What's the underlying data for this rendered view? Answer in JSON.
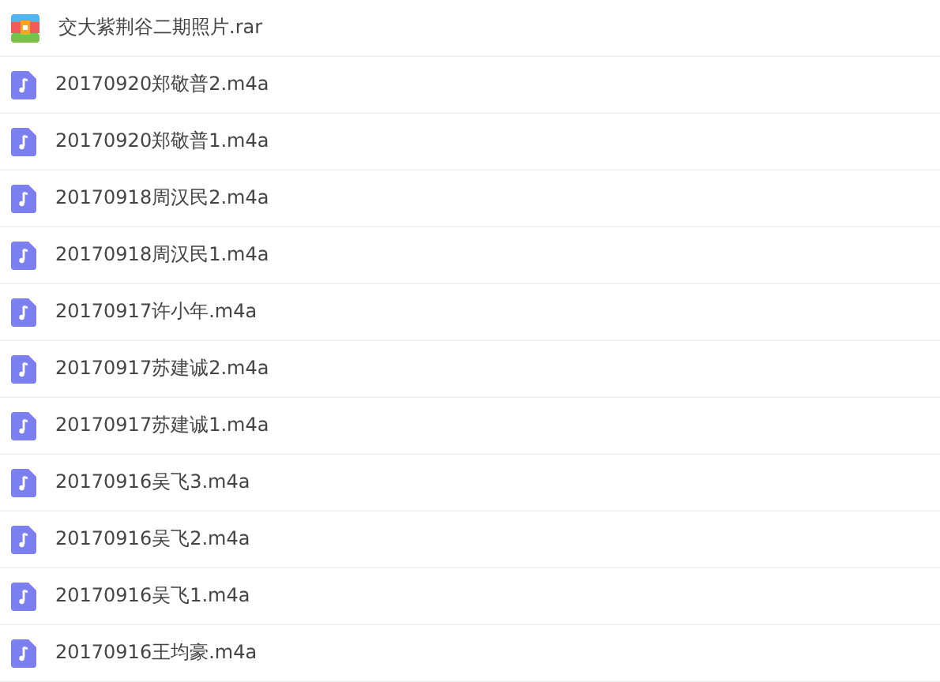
{
  "files": [
    {
      "kind": "archive",
      "name": "交大紫荆谷二期照片.rar"
    },
    {
      "kind": "audio",
      "name": "20170920郑敬普2.m4a"
    },
    {
      "kind": "audio",
      "name": "20170920郑敬普1.m4a"
    },
    {
      "kind": "audio",
      "name": "20170918周汉民2.m4a"
    },
    {
      "kind": "audio",
      "name": "20170918周汉民1.m4a"
    },
    {
      "kind": "audio",
      "name": "20170917许小年.m4a"
    },
    {
      "kind": "audio",
      "name": "20170917苏建诚2.m4a"
    },
    {
      "kind": "audio",
      "name": "20170917苏建诚1.m4a"
    },
    {
      "kind": "audio",
      "name": "20170916吴飞3.m4a"
    },
    {
      "kind": "audio",
      "name": "20170916吴飞2.m4a"
    },
    {
      "kind": "audio",
      "name": "20170916吴飞1.m4a"
    },
    {
      "kind": "audio",
      "name": "20170916王均豪.m4a"
    }
  ]
}
